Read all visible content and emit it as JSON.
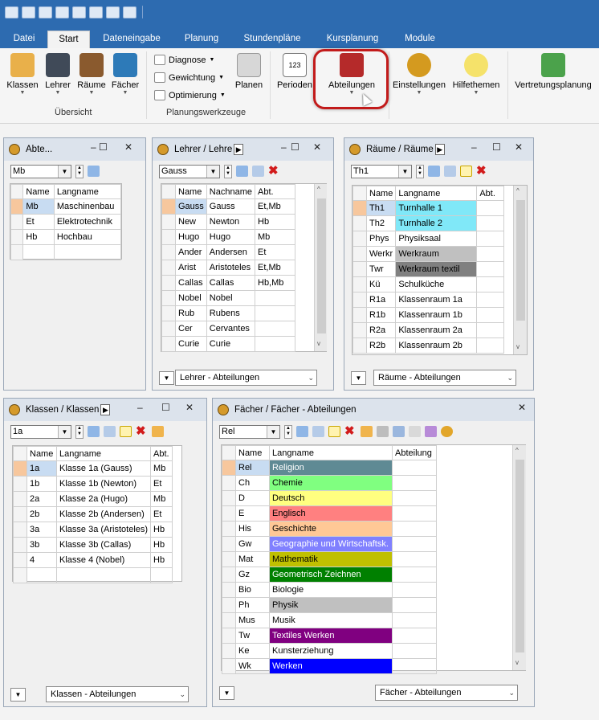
{
  "menu_tabs": [
    "Datei",
    "Start",
    "Dateneingabe",
    "Planung",
    "Stundenpläne",
    "Kursplanung",
    "Module"
  ],
  "ribbon": {
    "buttons": {
      "klassen": "Klassen",
      "lehrer": "Lehrer",
      "raeume": "Räume",
      "faecher": "Fächer",
      "planen": "Planen",
      "perioden": "Perioden",
      "abteilungen": "Abteilungen",
      "einstellungen": "Einstellungen",
      "hilfethemen": "Hilfethemen",
      "vertretungsplanung": "Vertretungsplanung"
    },
    "small": {
      "diagnose": "Diagnose",
      "gewichtung": "Gewichtung",
      "optimierung": "Optimierung"
    },
    "groups": {
      "uebersicht": "Übersicht",
      "planungswerkzeuge": "Planungswerkzeuge"
    }
  },
  "panel_abt": {
    "title": "Abte...",
    "combo": "Mb",
    "headers": [
      "Name",
      "Langname"
    ],
    "rows": [
      [
        "Mb",
        "Maschinenbau"
      ],
      [
        "Et",
        "Elektrotechnik"
      ],
      [
        "Hb",
        "Hochbau"
      ]
    ]
  },
  "panel_lehrer": {
    "title": "Lehrer / Lehre",
    "combo": "Gauss",
    "headers": [
      "Name",
      "Nachname",
      "Abt."
    ],
    "rows": [
      [
        "Gauss",
        "Gauss",
        "Et,Mb"
      ],
      [
        "New",
        "Newton",
        "Hb"
      ],
      [
        "Hugo",
        "Hugo",
        "Mb"
      ],
      [
        "Ander",
        "Andersen",
        "Et"
      ],
      [
        "Arist",
        "Aristoteles",
        "Et,Mb"
      ],
      [
        "Callas",
        "Callas",
        "Hb,Mb"
      ],
      [
        "Nobel",
        "Nobel",
        ""
      ],
      [
        "Rub",
        "Rubens",
        ""
      ],
      [
        "Cer",
        "Cervantes",
        ""
      ],
      [
        "Curie",
        "Curie",
        ""
      ]
    ],
    "footer": "Lehrer - Abteilungen"
  },
  "panel_raeume": {
    "title": "Räume / Räume",
    "combo": "Th1",
    "headers": [
      "Name",
      "Langname",
      "Abt."
    ],
    "rows": [
      [
        "Th1",
        "Turnhalle 1",
        ""
      ],
      [
        "Th2",
        "Turnhalle 2",
        ""
      ],
      [
        "Phys",
        "Physiksaal",
        ""
      ],
      [
        "Werkr",
        "Werkraum",
        ""
      ],
      [
        "Twr",
        "Werkraum textil",
        ""
      ],
      [
        "Kü",
        "Schulküche",
        ""
      ],
      [
        "R1a",
        "Klassenraum 1a",
        ""
      ],
      [
        "R1b",
        "Klassenraum 1b",
        ""
      ],
      [
        "R2a",
        "Klassenraum 2a",
        ""
      ],
      [
        "R2b",
        "Klassenraum 2b",
        ""
      ]
    ],
    "row_colors": [
      "#80e8f8",
      "#80e8f8",
      "",
      "#c0c0c0",
      "#808080",
      "",
      "",
      "",
      "",
      ""
    ],
    "footer": "Räume - Abteilungen"
  },
  "panel_klassen": {
    "title": "Klassen / Klassen",
    "combo": "1a",
    "headers": [
      "Name",
      "Langname",
      "Abt."
    ],
    "rows": [
      [
        "1a",
        "Klasse 1a (Gauss)",
        "Mb"
      ],
      [
        "1b",
        "Klasse 1b (Newton)",
        "Et"
      ],
      [
        "2a",
        "Klasse 2a (Hugo)",
        "Mb"
      ],
      [
        "2b",
        "Klasse 2b (Andersen)",
        "Et"
      ],
      [
        "3a",
        "Klasse 3a (Aristoteles)",
        "Hb"
      ],
      [
        "3b",
        "Klasse 3b (Callas)",
        "Hb"
      ],
      [
        "4",
        "Klasse 4 (Nobel)",
        "Hb"
      ]
    ],
    "footer": "Klassen - Abteilungen"
  },
  "panel_faecher": {
    "title": "Fächer / Fächer - Abteilungen",
    "combo": "Rel",
    "headers": [
      "Name",
      "Langname",
      "Abteilung"
    ],
    "rows": [
      [
        "Rel",
        "Religion",
        ""
      ],
      [
        "Ch",
        "Chemie",
        ""
      ],
      [
        "D",
        "Deutsch",
        ""
      ],
      [
        "E",
        "Englisch",
        ""
      ],
      [
        "His",
        "Geschichte",
        ""
      ],
      [
        "Gw",
        "Geographie und Wirtschaftsk.",
        ""
      ],
      [
        "Mat",
        "Mathematik",
        ""
      ],
      [
        "Gz",
        "Geometrisch Zeichnen",
        ""
      ],
      [
        "Bio",
        "Biologie",
        ""
      ],
      [
        "Ph",
        "Physik",
        ""
      ],
      [
        "Mus",
        "Musik",
        ""
      ],
      [
        "Tw",
        "Textiles Werken",
        ""
      ],
      [
        "Ke",
        "Kunsterziehung",
        ""
      ],
      [
        "Wk",
        "Werken",
        ""
      ]
    ],
    "row_colors": [
      "#5f8a94",
      "#80ff80",
      "#ffff80",
      "#ff8080",
      "#ffc896",
      "#8080ff",
      "#c0c000",
      "#008000",
      "",
      "#c0c0c0",
      "",
      "#800080",
      "",
      "#0000ff"
    ],
    "row_text_colors": [
      "#fff",
      "#000",
      "#000",
      "#000",
      "#000",
      "#fff",
      "#000",
      "#fff",
      "#000",
      "#000",
      "#000",
      "#fff",
      "#000",
      "#fff"
    ],
    "footer": "Fächer - Abteilungen"
  }
}
